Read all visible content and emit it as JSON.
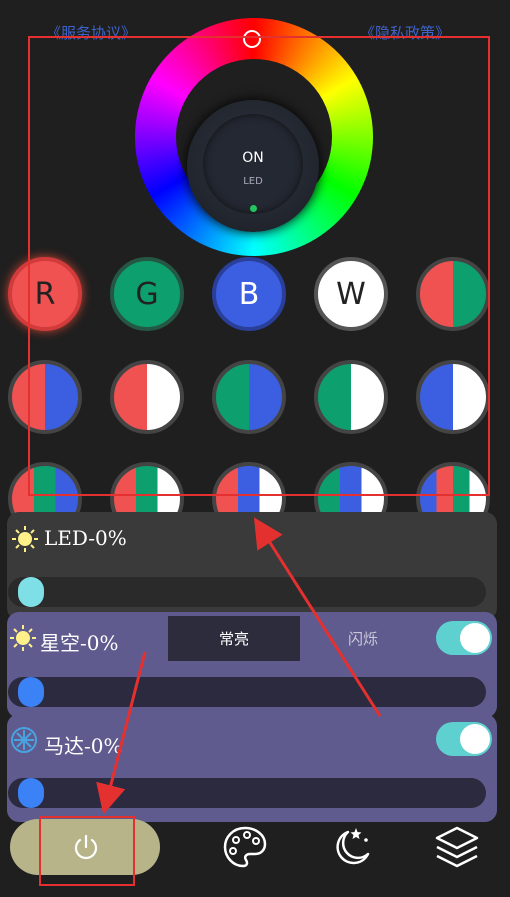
{
  "header": {
    "service_link": "《服务协议》",
    "privacy_link": "《隐私政策》"
  },
  "power_knob": {
    "state_label": "ON",
    "device_label": "LED"
  },
  "color_buttons": [
    {
      "label": "R"
    },
    {
      "label": "G"
    },
    {
      "label": "B"
    },
    {
      "label": "W"
    }
  ],
  "colors": {
    "red": "#f05252",
    "green": "#0e9f6e",
    "blue": "#3b5fe0",
    "white": "#ffffff",
    "accent_teal": "#5fd0d0",
    "annotation_red": "#e53030",
    "power_pill": "#b7b48a"
  },
  "panels": {
    "led": {
      "title": "LED-0%",
      "level": 0
    },
    "starry": {
      "title": "星空-0%",
      "level": 0,
      "mode_steady": "常亮",
      "mode_flash": "闪烁",
      "toggle_on": true
    },
    "motor": {
      "title": "马达-0%",
      "level": 0,
      "toggle_on": true
    }
  },
  "bottom_nav": [
    {
      "icon": "power-icon"
    },
    {
      "icon": "palette-icon"
    },
    {
      "icon": "moon-stars-icon"
    },
    {
      "icon": "layers-icon"
    }
  ]
}
